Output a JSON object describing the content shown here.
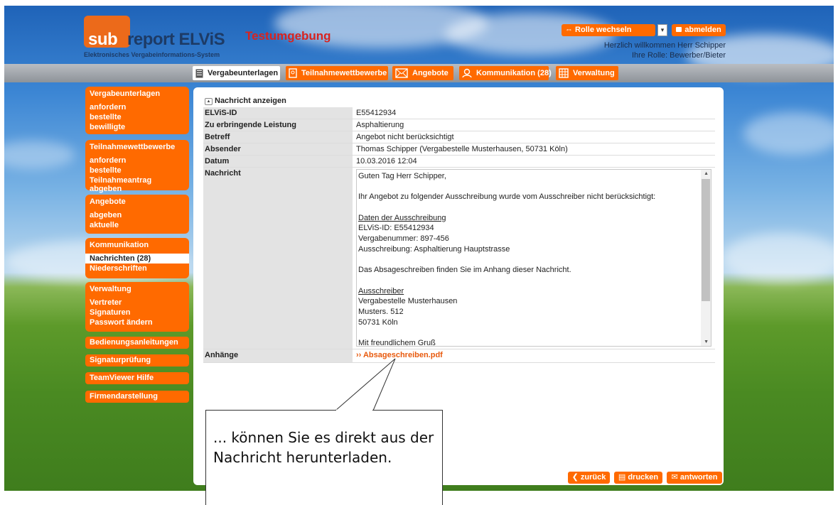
{
  "header": {
    "logo_sub": "sub",
    "logo_rest": "report ELViS",
    "logo_tagline": "Elektronisches Vergabeinformations-System",
    "environment": "Testumgebung",
    "role_button": "⇔ Rolle wechseln",
    "logout": "abmelden",
    "welcome": "Herzlich willkommen Herr Schipper",
    "role": "Ihre Rolle: Bewerber/Bieter"
  },
  "nav": {
    "tabs": [
      {
        "label": "Vergabeunterlagen",
        "icon": "document-icon",
        "active": true
      },
      {
        "label": "Teilnahmewettbewerbe",
        "icon": "badge-icon",
        "active": false
      },
      {
        "label": "Angebote",
        "icon": "envelope-icon",
        "active": false
      },
      {
        "label": "Kommunikation (28)",
        "icon": "person-icon",
        "active": false
      },
      {
        "label": "Verwaltung",
        "icon": "grid-icon",
        "active": false
      }
    ]
  },
  "sidebar": {
    "groups": [
      {
        "head": "Vergabeunterlagen",
        "items": [
          "anfordern",
          "bestellte",
          "bewilligte"
        ]
      },
      {
        "head": "Teilnahmewettbewerbe",
        "items": [
          "anfordern",
          "bestellte",
          "Teilnahmeantrag abgeben"
        ]
      },
      {
        "head": "Angebote",
        "items": [
          "abgeben",
          "aktuelle"
        ]
      },
      {
        "head": "Kommunikation",
        "items": [
          "Nachrichten (28)",
          "Niederschriften"
        ]
      },
      {
        "head": "Verwaltung",
        "items": [
          "Vertreter",
          "Signaturen",
          "Passwort ändern"
        ]
      }
    ],
    "buttons": [
      "Bedienungsanleitungen",
      "Signaturprüfung",
      "TeamViewer Hilfe",
      "Firmendarstellung"
    ]
  },
  "message": {
    "section_title": "Nachricht anzeigen",
    "fields": [
      {
        "label": "ELViS-ID",
        "value": "E55412934"
      },
      {
        "label": "Zu erbringende Leistung",
        "value": "Asphaltierung"
      },
      {
        "label": "Betreff",
        "value": "Angebot nicht berücksichtigt"
      },
      {
        "label": "Absender",
        "value": "Thomas Schipper (Vergabestelle Musterhausen, 50731 Köln)"
      },
      {
        "label": "Datum",
        "value": "10.03.2016 12:04"
      }
    ],
    "body_label": "Nachricht",
    "body_lines": [
      "Guten Tag Herr Schipper,",
      "",
      "Ihr Angebot zu folgender Ausschreibung wurde vom Ausschreiber nicht berücksichtigt:",
      "",
      "Daten der Ausschreibung",
      "ELViS-ID: E55412934",
      "Vergabenummer: 897-456",
      "Ausschreibung: Asphaltierung Hauptstrasse",
      "",
      "Das Absageschreiben finden Sie im Anhang dieser Nachricht.",
      "",
      "Ausschreiber",
      "Vergabestelle Musterhausen",
      "Musters. 512",
      "50731 Köln",
      "",
      "Mit freundlichem Gruß"
    ],
    "attachments_label": "Anhänge",
    "attachment": "›› Absageschreiben.pdf"
  },
  "actions": {
    "back": "zurück",
    "print": "drucken",
    "reply": "antworten"
  },
  "callout": {
    "text": "... können Sie es direkt aus der Nachricht herunterladen."
  }
}
